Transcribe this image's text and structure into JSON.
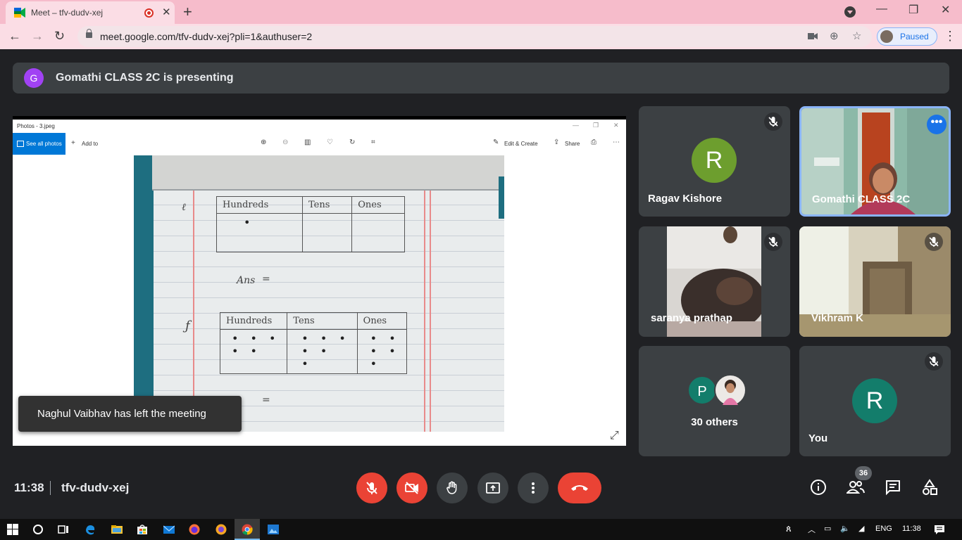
{
  "browser": {
    "tab_title": "Meet – tfv-dudv-xej",
    "url": "meet.google.com/tfv-dudv-xej?pli=1&authuser=2",
    "profile_label": "Paused",
    "colors": {
      "tabstrip": "#f6bccb",
      "toolbar": "#fbdde5"
    }
  },
  "presenting": {
    "avatar_letter": "G",
    "text": "Gomathi CLASS 2C is presenting"
  },
  "shared_window": {
    "title": "Photos - 3.jpeg",
    "see_all": "See all photos",
    "add_to": "Add to",
    "edit_create": "Edit & Create",
    "share": "Share"
  },
  "photo": {
    "table1_headers": [
      "Hundreds",
      "Tens",
      "Ones"
    ],
    "table2_headers": [
      "Hundreds",
      "Tens",
      "Ones"
    ],
    "ans_label": "Ans"
  },
  "toast": "Naghul Vaibhav has left the meeting",
  "tiles": [
    {
      "name": "Ragav Kishore",
      "avatar_letter": "R",
      "avatar_color": "#6d9e2e",
      "muted": true
    },
    {
      "name": "Gomathi CLASS 2C",
      "muted": false
    },
    {
      "name": "saranya prathap",
      "muted": true
    },
    {
      "name": "Vikhram K",
      "muted": true
    },
    {
      "name": "30 others",
      "avatar_letter": "P",
      "avatar_color": "#137d6b"
    },
    {
      "name": "You",
      "avatar_letter": "R",
      "avatar_color": "#137d6b",
      "muted": true
    }
  ],
  "meeting": {
    "time": "11:38",
    "code": "tfv-dudv-xej",
    "participant_count": "36"
  },
  "controls": {
    "mic_color": "#ea4335",
    "end_color": "#ea4335"
  },
  "taskbar": {
    "lang": "ENG",
    "time": "11:38"
  }
}
